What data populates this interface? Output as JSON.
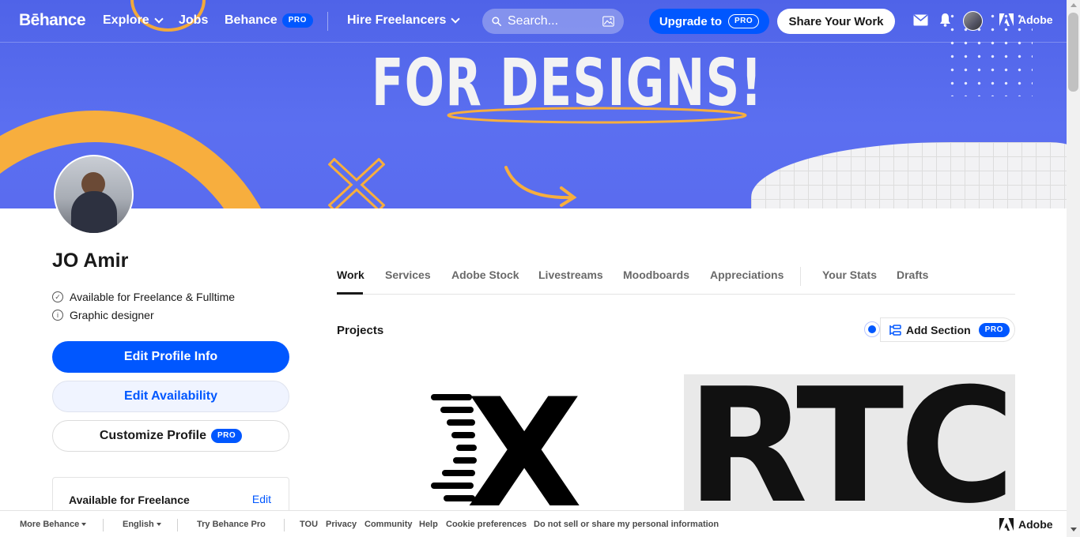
{
  "banner": {
    "headline": "FOR DESIGNS!"
  },
  "nav": {
    "logo": "Bēhance",
    "explore": "Explore",
    "jobs": "Jobs",
    "behance": "Behance",
    "pro": "PRO",
    "hire": "Hire Freelancers",
    "search_placeholder": "Search...",
    "upgrade": "Upgrade to",
    "share": "Share Your Work",
    "adobe": "Adobe"
  },
  "profile": {
    "name": "JO Amir",
    "availability": "Available for Freelance & Fulltime",
    "role": "Graphic designer",
    "edit_profile": "Edit Profile Info",
    "edit_availability": "Edit Availability",
    "customize": "Customize Profile",
    "freelance_card_title": "Available for Freelance",
    "freelance_card_edit": "Edit"
  },
  "tabs": [
    {
      "label": "Work"
    },
    {
      "label": "Services"
    },
    {
      "label": "Adobe Stock"
    },
    {
      "label": "Livestreams"
    },
    {
      "label": "Moodboards"
    },
    {
      "label": "Appreciations"
    },
    {
      "label": "Your Stats"
    },
    {
      "label": "Drafts"
    }
  ],
  "projects": {
    "label": "Projects",
    "add_section": "Add Section",
    "thumb1_text": "X",
    "thumb2_text": "RTC"
  },
  "footer": {
    "more": "More Behance",
    "language": "English",
    "try_pro": "Try Behance Pro",
    "tou": "TOU",
    "privacy": "Privacy",
    "community": "Community",
    "help": "Help",
    "cookies": "Cookie preferences",
    "do_not_sell": "Do not sell or share my personal information",
    "adobe": "Adobe"
  },
  "colors": {
    "brand_blue": "#0057ff",
    "banner_blue": "#5b6ff0",
    "accent_orange": "#f7ae3e"
  }
}
